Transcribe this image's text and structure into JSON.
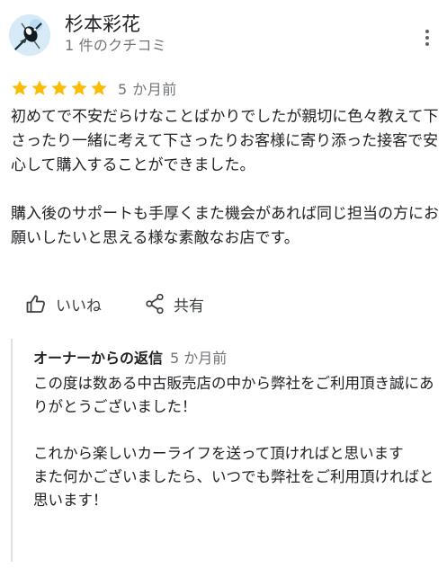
{
  "author": {
    "name": "杉本彩花",
    "meta": "1 件のクチコミ"
  },
  "review": {
    "rating": 5,
    "max_rating": 5,
    "time": "5 か月前",
    "text": "初めてで不安だらけなことばかりでしたが親切に色々教えて下さったり一緒に考えて下さったりお客様に寄り添った接客で安心して購入することができました。\n\n購入後のサポートも手厚くまた機会があれば同じ担当の方にお願いしたいと思える様な素敵なお店です。"
  },
  "actions": {
    "like_label": "いいね",
    "share_label": "共有"
  },
  "owner_reply": {
    "author": "オーナーからの返信",
    "time": "5 か月前",
    "text": "この度は数ある中古販売店の中から弊社をご利用頂き誠にありがとうございました！\n\nこれから楽しいカーライフを送って頂ければと思います\nまた何かございましたら、いつでも弊社をご利用頂ければと思います！"
  },
  "colors": {
    "star": "#fbbc04",
    "secondary_text": "#70757a",
    "reply_border": "#e0e0e0"
  },
  "icons": {
    "more": "more-vert-icon",
    "like": "thumb-up-icon",
    "share": "share-icon",
    "star": "star-icon"
  }
}
